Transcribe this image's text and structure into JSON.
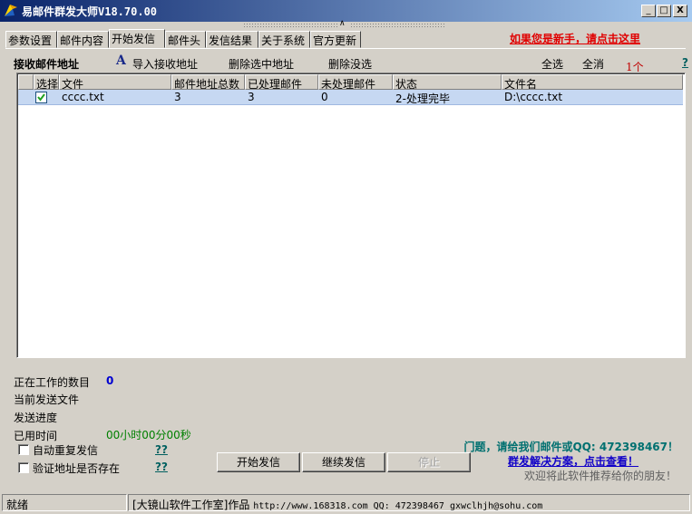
{
  "window": {
    "title": "易邮件群发大师V18.70.00",
    "controls": {
      "minimize": "_",
      "maximize": "□",
      "close": "X"
    }
  },
  "tabs": [
    "参数设置",
    "邮件内容",
    "开始发信",
    "邮件头",
    "发信结果",
    "关于系统",
    "官方更新"
  ],
  "active_tab": "开始发信",
  "newbie_link": "如果您是新手，请点击这里",
  "toolbar": {
    "section_label": "接收邮件地址",
    "import_icon_glyph": "A",
    "import_label": "导入接收地址",
    "delete_selected_label": "删除选中地址",
    "delete_unselected_label": "删除没选",
    "select_all_label": "全选",
    "deselect_all_label": "全消",
    "count_label": "1个",
    "help_glyph": "?"
  },
  "table": {
    "columns": [
      "选择",
      "文件",
      "邮件地址总数",
      "已处理邮件",
      "未处理邮件",
      "状态",
      "文件名"
    ],
    "rows": [
      {
        "checked": true,
        "file": "cccc.txt",
        "total": "3",
        "processed": "3",
        "unprocessed": "0",
        "status": "2-处理完毕",
        "filename": "D:\\cccc.txt"
      }
    ]
  },
  "status_info": {
    "working_count_label": "正在工作的数目",
    "working_count_value": "0",
    "current_file_label": "当前发送文件",
    "progress_label": "发送进度",
    "elapsed_label": "已用时间",
    "elapsed_value": "00小时00分00秒"
  },
  "options": [
    {
      "label": "自动重复发信",
      "checked": false,
      "help": "??"
    },
    {
      "label": "验证地址是否存在",
      "checked": false,
      "help": "??"
    }
  ],
  "buttons": {
    "start": "开始发信",
    "continue": "继续发信",
    "stop": "停止"
  },
  "promo": {
    "contact": "门题，请给我们邮件或QQ: 472398467！",
    "solution": "群发解决方案，点击查看！",
    "recommend": "欢迎将此软件推荐给你的朋友！"
  },
  "statusbar": {
    "ready": "就绪",
    "studio": "[大镜山软件工作室]作品",
    "contact_info": "http://www.168318.com QQ: 472398467 gxwclhjh@sohu.com"
  },
  "colors": {
    "face": "#d4d0c8",
    "title_start": "#0a246a",
    "title_end": "#a6caf0",
    "selected_row": "#c6d8f2",
    "link_red": "#e00000",
    "link_blue": "#1000c8",
    "accent_teal": "#007070"
  }
}
